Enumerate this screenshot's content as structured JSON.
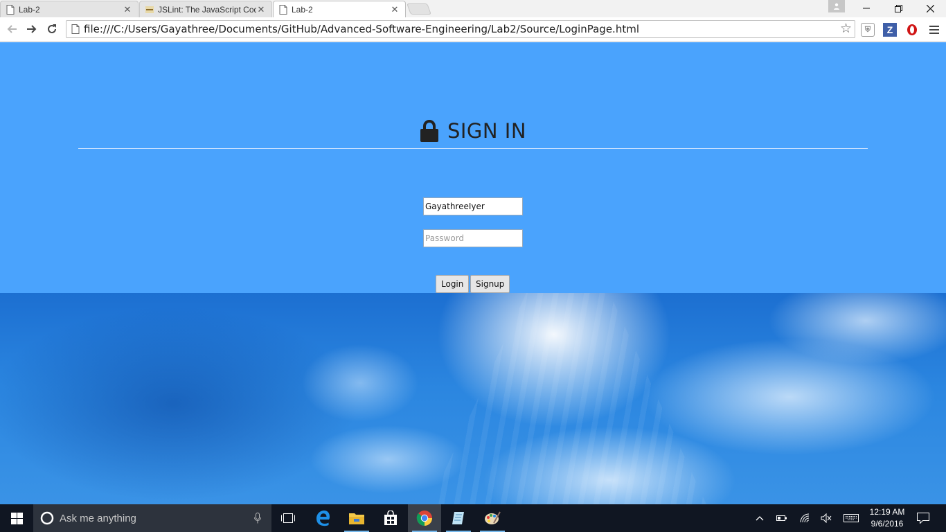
{
  "browser": {
    "tabs": [
      {
        "title": "Lab-2",
        "active": false
      },
      {
        "title": "JSLint: The JavaScript Code",
        "active": false
      },
      {
        "title": "Lab-2",
        "active": true
      }
    ],
    "address": "file:///C:/Users/Gayathree/Documents/GitHub/Advanced-Software-Engineering/Lab2/Source/LoginPage.html",
    "extensions": {
      "z_label": "Z"
    }
  },
  "page": {
    "heading": "SIGN IN",
    "username": {
      "value": "GayathreeIyer"
    },
    "password": {
      "placeholder": "Password"
    },
    "login_button": "Login",
    "signup_button": "Signup"
  },
  "taskbar": {
    "search_placeholder": "Ask me anything",
    "time": "12:19 AM",
    "date": "9/6/2016"
  },
  "colors": {
    "page_blue": "#4aa3fd",
    "taskbar": "#101622",
    "search_box": "#2d333d"
  }
}
